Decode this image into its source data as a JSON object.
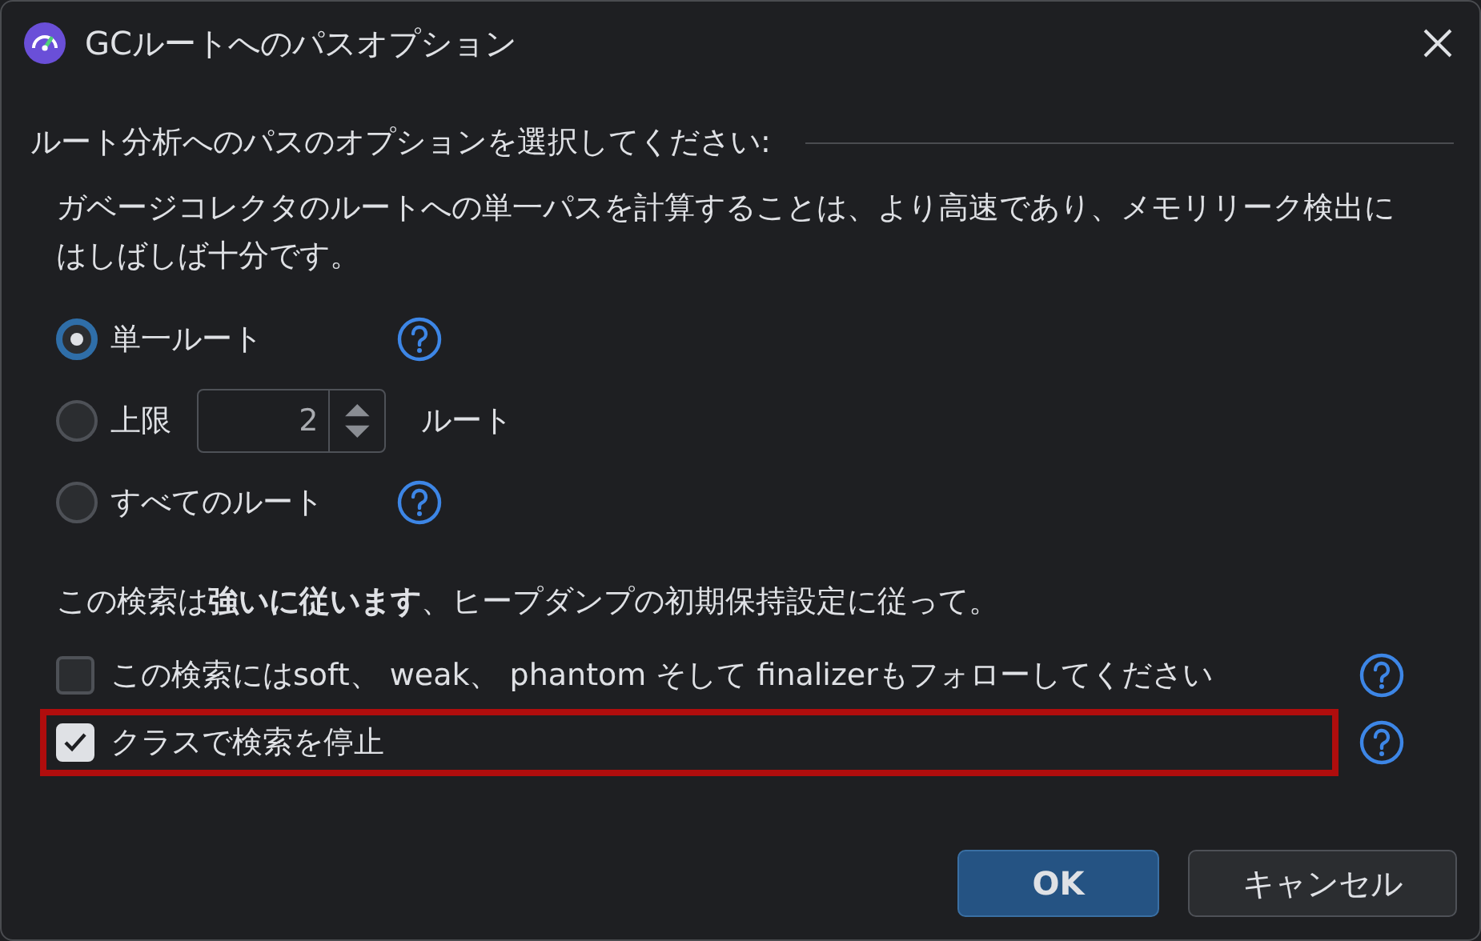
{
  "window": {
    "title": "GCルートへのパスオプション"
  },
  "section_title": "ルート分析へのパスのオプションを選択してください:",
  "description": "ガベージコレクタのルートへの単一パスを計算することは、より高速であり、メモリリーク検出にはしばしば十分です。",
  "options": [
    {
      "kind": "plain",
      "label": "単一ルート",
      "selected": true,
      "help": true
    },
    {
      "kind": "limit",
      "label": "上限",
      "value": "2",
      "suffix": "ルート",
      "selected": false,
      "help": false
    },
    {
      "kind": "plain",
      "label": "すべてのルート",
      "selected": false,
      "help": true
    }
  ],
  "note": "この検索は**強いに従います**、ヒープダンプの初期保持設定に従って。",
  "checkboxes": [
    {
      "label": "この検索にはsoft、 weak、 phantom そして finalizerもフォローしてください",
      "checked": false,
      "highlighted": false
    },
    {
      "label": "クラスで検索を停止",
      "checked": true,
      "highlighted": true
    }
  ],
  "buttons": [
    {
      "label": "OK",
      "kind": "primary"
    },
    {
      "label": "キャンセル",
      "kind": "secondary"
    }
  ]
}
